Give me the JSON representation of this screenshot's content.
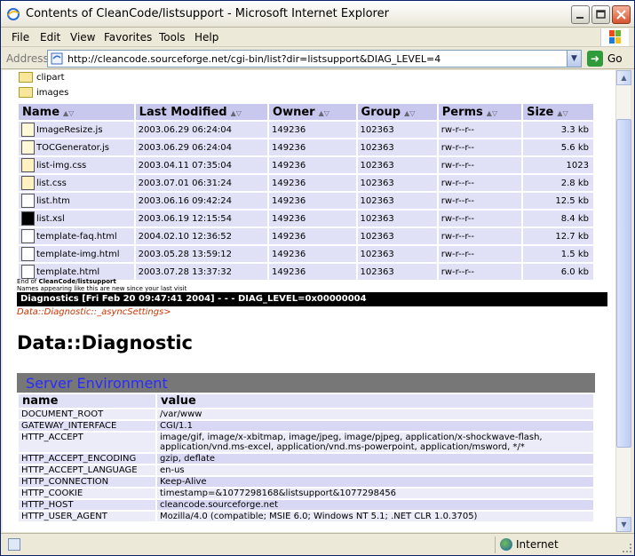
{
  "window": {
    "title": "Contents of CleanCode/listsupport - Microsoft Internet Explorer"
  },
  "menu": {
    "items": [
      "File",
      "Edit",
      "View",
      "Favorites",
      "Tools",
      "Help"
    ]
  },
  "address": {
    "label": "Address",
    "url": "http://cleancode.sourceforge.net/cgi-bin/list?dir=listsupport&DIAG_LEVEL=4",
    "go_label": "Go"
  },
  "directories": [
    "clipart",
    "images"
  ],
  "table": {
    "columns": [
      "Name",
      "Last Modified",
      "Owner",
      "Group",
      "Perms",
      "Size"
    ],
    "rows": [
      {
        "icon": "js-file-icon",
        "name": "ImageResize.js",
        "modified": "2003.06.29 06:24:04",
        "owner": "149236",
        "group": "102363",
        "perms": "rw-r--r--",
        "size": "3.3 kb"
      },
      {
        "icon": "js-file-icon",
        "name": "TOCGenerator.js",
        "modified": "2003.06.29 06:24:04",
        "owner": "149236",
        "group": "102363",
        "perms": "rw-r--r--",
        "size": "5.6 kb"
      },
      {
        "icon": "css-file-icon",
        "name": "list-img.css",
        "modified": "2003.04.11 07:35:04",
        "owner": "149236",
        "group": "102363",
        "perms": "rw-r--r--",
        "size": "1023"
      },
      {
        "icon": "css-file-icon",
        "name": "list.css",
        "modified": "2003.07.01 06:31:24",
        "owner": "149236",
        "group": "102363",
        "perms": "rw-r--r--",
        "size": "2.8 kb"
      },
      {
        "icon": "html-file-icon",
        "name": "list.htm",
        "modified": "2003.06.16 09:42:24",
        "owner": "149236",
        "group": "102363",
        "perms": "rw-r--r--",
        "size": "12.5 kb"
      },
      {
        "icon": "xsl-file-icon",
        "name": "list.xsl",
        "modified": "2003.06.19 12:15:54",
        "owner": "149236",
        "group": "102363",
        "perms": "rw-r--r--",
        "size": "8.4 kb"
      },
      {
        "icon": "html-file-icon",
        "name": "template-faq.html",
        "modified": "2004.02.10 12:36:52",
        "owner": "149236",
        "group": "102363",
        "perms": "rw-r--r--",
        "size": "12.7 kb"
      },
      {
        "icon": "html-file-icon",
        "name": "template-img.html",
        "modified": "2003.05.28 13:59:12",
        "owner": "149236",
        "group": "102363",
        "perms": "rw-r--r--",
        "size": "1.5 kb"
      },
      {
        "icon": "html-file-icon",
        "name": "template.html",
        "modified": "2003.07.28 13:37:32",
        "owner": "149236",
        "group": "102363",
        "perms": "rw-r--r--",
        "size": "6.0 kb"
      }
    ]
  },
  "footer": {
    "end_prefix": "End of ",
    "end_path": "CleanCode/listsupport",
    "note": "Names appearing like this are new since your last visit"
  },
  "diagnostics": {
    "bar": "Diagnostics [Fri Feb 20 09:47:41 2004] - - - DIAG_LEVEL=0x00000004",
    "sub": "Data::Diagnostic::_asyncSettings>",
    "title": "Data::Diagnostic"
  },
  "environment": {
    "heading": "Server Environment",
    "col_name": "name",
    "col_value": "value",
    "rows": [
      {
        "name": "DOCUMENT_ROOT",
        "value": "/var/www"
      },
      {
        "name": "GATEWAY_INTERFACE",
        "value": "CGI/1.1"
      },
      {
        "name": "HTTP_ACCEPT",
        "value": "image/gif, image/x-xbitmap, image/jpeg, image/pjpeg, application/x-shockwave-flash, application/vnd.ms-excel, application/vnd.ms-powerpoint, application/msword, */*"
      },
      {
        "name": "HTTP_ACCEPT_ENCODING",
        "value": "gzip, deflate"
      },
      {
        "name": "HTTP_ACCEPT_LANGUAGE",
        "value": "en-us"
      },
      {
        "name": "HTTP_CONNECTION",
        "value": "Keep-Alive"
      },
      {
        "name": "HTTP_COOKIE",
        "value": "timestamp=&1077298168&listsupport&1077298456"
      },
      {
        "name": "HTTP_HOST",
        "value": "cleancode.sourceforge.net"
      },
      {
        "name": "HTTP_USER_AGENT",
        "value": "Mozilla/4.0 (compatible; MSIE 6.0; Windows NT 5.1; .NET CLR 1.0.3705)"
      }
    ]
  },
  "status": {
    "zone": "Internet"
  }
}
